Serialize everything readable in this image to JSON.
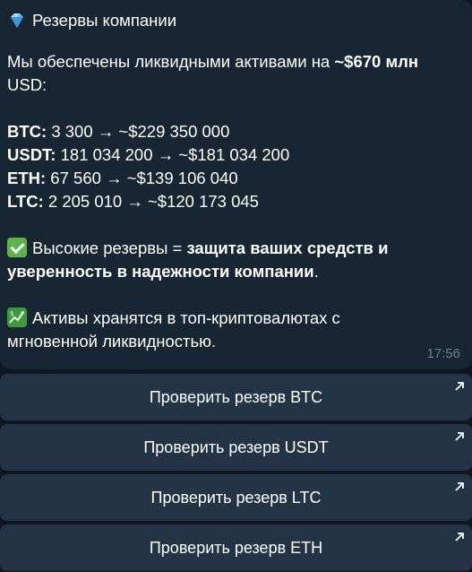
{
  "message": {
    "title": "Резервы компании",
    "intro_prefix": "Мы обеспечены ликвидными активами на ",
    "intro_amount": "~$670 млн",
    "intro_suffix": "USD:",
    "reserves": [
      {
        "asset": "BTC:",
        "value": " 3 300 → ~$229 350 000"
      },
      {
        "asset": "USDT:",
        "value": " 181 034 200 → ~$181 034 200"
      },
      {
        "asset": "ETH:",
        "value": " 67 560 → ~$139 106 040"
      },
      {
        "asset": "LTC:",
        "value": " 2 205 010 → ~$120 173 045"
      }
    ],
    "high_reserves_prefix": "Высокие резервы = ",
    "high_reserves_bold_1": "защита ваших средств и",
    "high_reserves_bold_2": "уверенность в надежности компании",
    "high_reserves_end": ".",
    "assets_line_1": "Активы хранятся в топ-криптовалютах с",
    "assets_line_2": "мгновенной ликвидностью.",
    "time": "17:56"
  },
  "buttons": [
    {
      "label": "Проверить резерв BTC"
    },
    {
      "label": "Проверить резерв USDT"
    },
    {
      "label": "Проверить резерв LTC"
    },
    {
      "label": "Проверить резерв ETH"
    }
  ],
  "icons": {
    "title": "gem-icon",
    "check": "check-mark-icon",
    "chart": "chart-increasing-icon",
    "button": "external-link-arrow-icon"
  }
}
